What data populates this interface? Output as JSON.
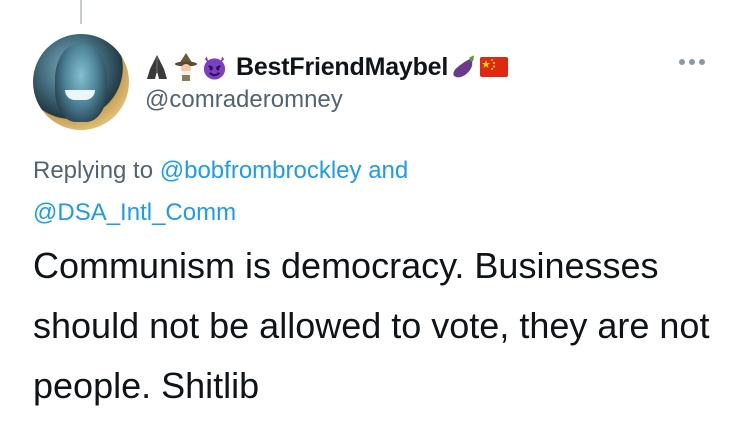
{
  "tweet": {
    "display_name": "BestFriendMaybel",
    "handle": "@comraderomney",
    "name_emojis": [
      "folded-hands-icon",
      "mage-icon",
      "smiling-devil-icon"
    ],
    "name_suffix_emojis": [
      "eggplant-icon",
      "china-flag-icon"
    ],
    "reply": {
      "prefix": "Replying to",
      "mention1": "@bobfrombrockley",
      "joiner": "and",
      "mention2": "@DSA_Intl_Comm"
    },
    "text": "Communism is democracy. Businesses should not be allowed to vote, they are not people. Shitlib"
  },
  "colors": {
    "link": "#1d9bf0",
    "secondary_text": "#536471",
    "primary_text": "#0f1419",
    "devil": "#7b3fc4",
    "flag_red": "#de2910",
    "flag_star": "#ffde00",
    "eggplant": "#6b3a8c"
  }
}
